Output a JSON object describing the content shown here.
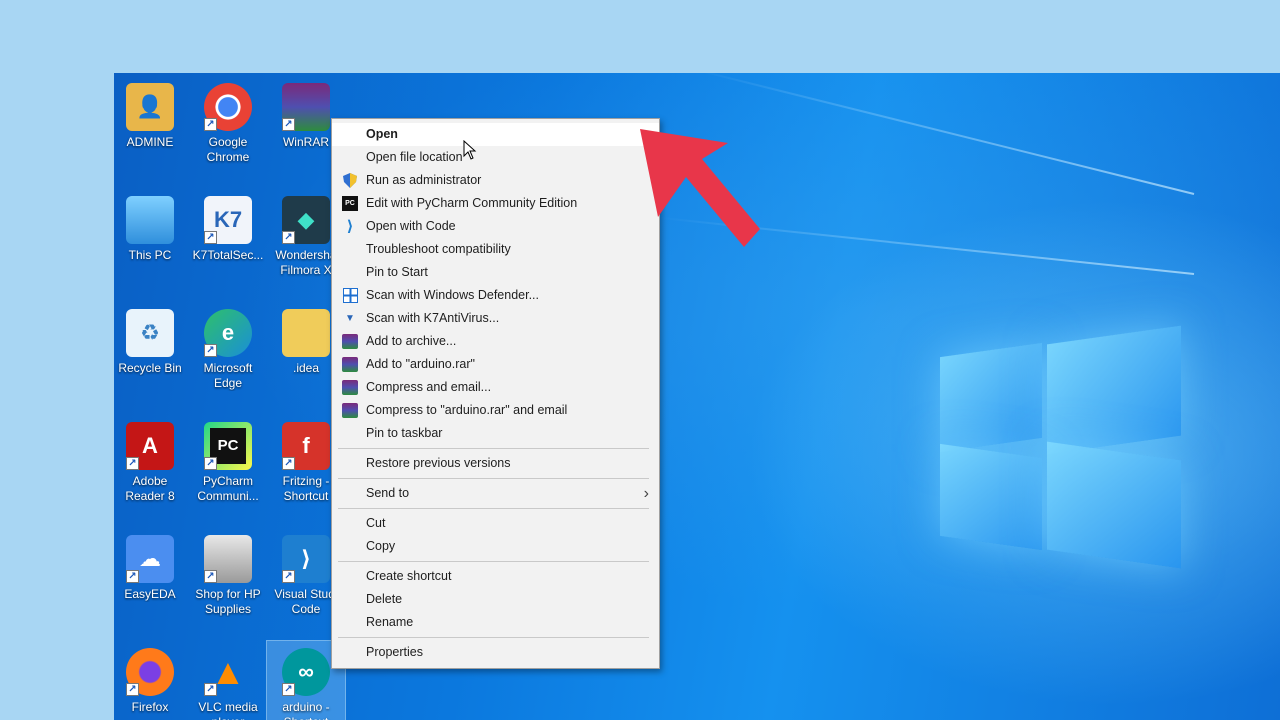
{
  "desktop_icons": [
    {
      "label": "ADMINE",
      "icon": "user-folder-icon",
      "color": "#e8b64a",
      "glyph": "👤"
    },
    {
      "label": "Google\nChrome",
      "icon": "chrome-icon",
      "color": "#e94235",
      "glyph": "◉"
    },
    {
      "label": "WinRAR",
      "icon": "winrar-icon",
      "color": "#8b2a5a",
      "glyph": "▤"
    },
    {
      "label": "This PC",
      "icon": "computer-icon",
      "color": "#5fb3f0",
      "glyph": "🖥"
    },
    {
      "label": "K7TotalSec...",
      "icon": "k7-icon",
      "color": "#2a66b8",
      "glyph": "K7"
    },
    {
      "label": "Wondersha\nFilmora X",
      "icon": "filmora-icon",
      "color": "#1f3b4a",
      "glyph": "◆"
    },
    {
      "label": "Recycle Bin",
      "icon": "recycle-bin-icon",
      "color": "#cfe6f5",
      "glyph": "♻"
    },
    {
      "label": "Microsoft\nEdge",
      "icon": "edge-icon",
      "color": "#1aa0b8",
      "glyph": "e"
    },
    {
      "label": ".idea",
      "icon": "folder-icon",
      "color": "#f0cc5a",
      "glyph": "📁"
    },
    {
      "label": "Adobe\nReader 8",
      "icon": "adobe-reader-icon",
      "color": "#c41616",
      "glyph": "A"
    },
    {
      "label": "PyCharm\nCommuni...",
      "icon": "pycharm-icon",
      "color": "#111111",
      "glyph": "PC"
    },
    {
      "label": "Fritzing -\nShortcut",
      "icon": "fritzing-icon",
      "color": "#d6332a",
      "glyph": "f"
    },
    {
      "label": "EasyEDA",
      "icon": "easyeda-icon",
      "color": "#4b8ef0",
      "glyph": "☁"
    },
    {
      "label": "Shop for HP\nSupplies",
      "icon": "hp-printer-icon",
      "color": "#d8d8d8",
      "glyph": "🖨"
    },
    {
      "label": "Visual Studi\nCode",
      "icon": "vscode-icon",
      "color": "#1e7fd0",
      "glyph": "⟩"
    },
    {
      "label": "Firefox",
      "icon": "firefox-icon",
      "color": "#ff7a1a",
      "glyph": "🦊"
    },
    {
      "label": "VLC media\nplayer",
      "icon": "vlc-icon",
      "color": "#ff8c00",
      "glyph": "▲"
    },
    {
      "label": "arduino -\nShortcut",
      "icon": "arduino-icon",
      "color": "#00979d",
      "glyph": "∞"
    }
  ],
  "context_menu": {
    "items": [
      {
        "label": "Open",
        "bold": true,
        "icon": ""
      },
      {
        "label": "Open file location",
        "icon": ""
      },
      {
        "label": "Run as administrator",
        "icon": "uac-shield-icon"
      },
      {
        "label": "Edit with PyCharm Community Edition",
        "icon": "pycharm-icon"
      },
      {
        "label": "Open with Code",
        "icon": "vscode-icon"
      },
      {
        "label": "Troubleshoot compatibility",
        "icon": ""
      },
      {
        "label": "Pin to Start",
        "icon": ""
      },
      {
        "label": "Scan with Windows Defender...",
        "icon": "defender-icon"
      },
      {
        "label": "Scan with K7AntiVirus...",
        "icon": "k7-icon"
      },
      {
        "label": "Add to archive...",
        "icon": "winrar-icon"
      },
      {
        "label": "Add to \"arduino.rar\"",
        "icon": "winrar-icon"
      },
      {
        "label": "Compress and email...",
        "icon": "winrar-icon"
      },
      {
        "label": "Compress to \"arduino.rar\" and email",
        "icon": "winrar-icon"
      },
      {
        "label": "Pin to taskbar",
        "icon": ""
      },
      {
        "label": "Restore previous versions",
        "icon": ""
      },
      {
        "label": "Send to",
        "icon": "",
        "submenu": true
      },
      {
        "label": "Cut",
        "icon": ""
      },
      {
        "label": "Copy",
        "icon": ""
      },
      {
        "label": "Create shortcut",
        "icon": ""
      },
      {
        "label": "Delete",
        "icon": ""
      },
      {
        "label": "Rename",
        "icon": ""
      },
      {
        "label": "Properties",
        "icon": ""
      }
    ]
  },
  "colors": {
    "annotation_arrow": "#e8364a",
    "desktop_blue": "#0b78de",
    "frame": "#a8d6f3"
  }
}
